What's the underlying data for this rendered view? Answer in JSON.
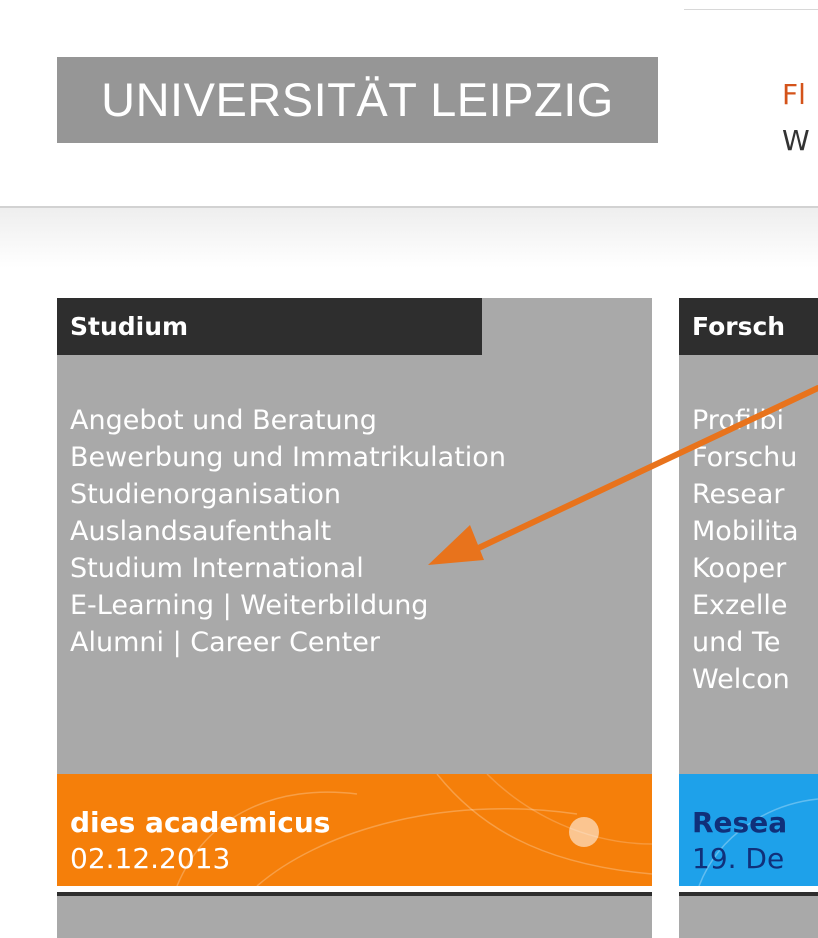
{
  "header": {
    "logo_text": "UNIVERSITÄT LEIPZIG",
    "right_line1": "Fl",
    "right_line2": "W"
  },
  "columns": [
    {
      "title": "Studium",
      "links": [
        "Angebot und Beratung",
        "Bewerbung und Immatrikulation",
        "Studienorganisation",
        "Auslandsaufenthalt",
        "Studium International",
        "E-Learning | Weiterbildung",
        "Alumni | Career Center"
      ],
      "banner": {
        "title": "dies academicus",
        "date": "02.12.2013",
        "color": "#f57f0a"
      }
    },
    {
      "title": "Forsch",
      "links": [
        "Profilbi",
        "Forschu",
        "Resear",
        "Mobilita",
        "Kooper",
        "Exzelle",
        "und Te",
        "Welcon"
      ],
      "banner": {
        "title": "Resea",
        "date": "19. De",
        "color": "#1ea1ea"
      }
    }
  ],
  "annotation": {
    "arrow_color": "#e8731c"
  }
}
